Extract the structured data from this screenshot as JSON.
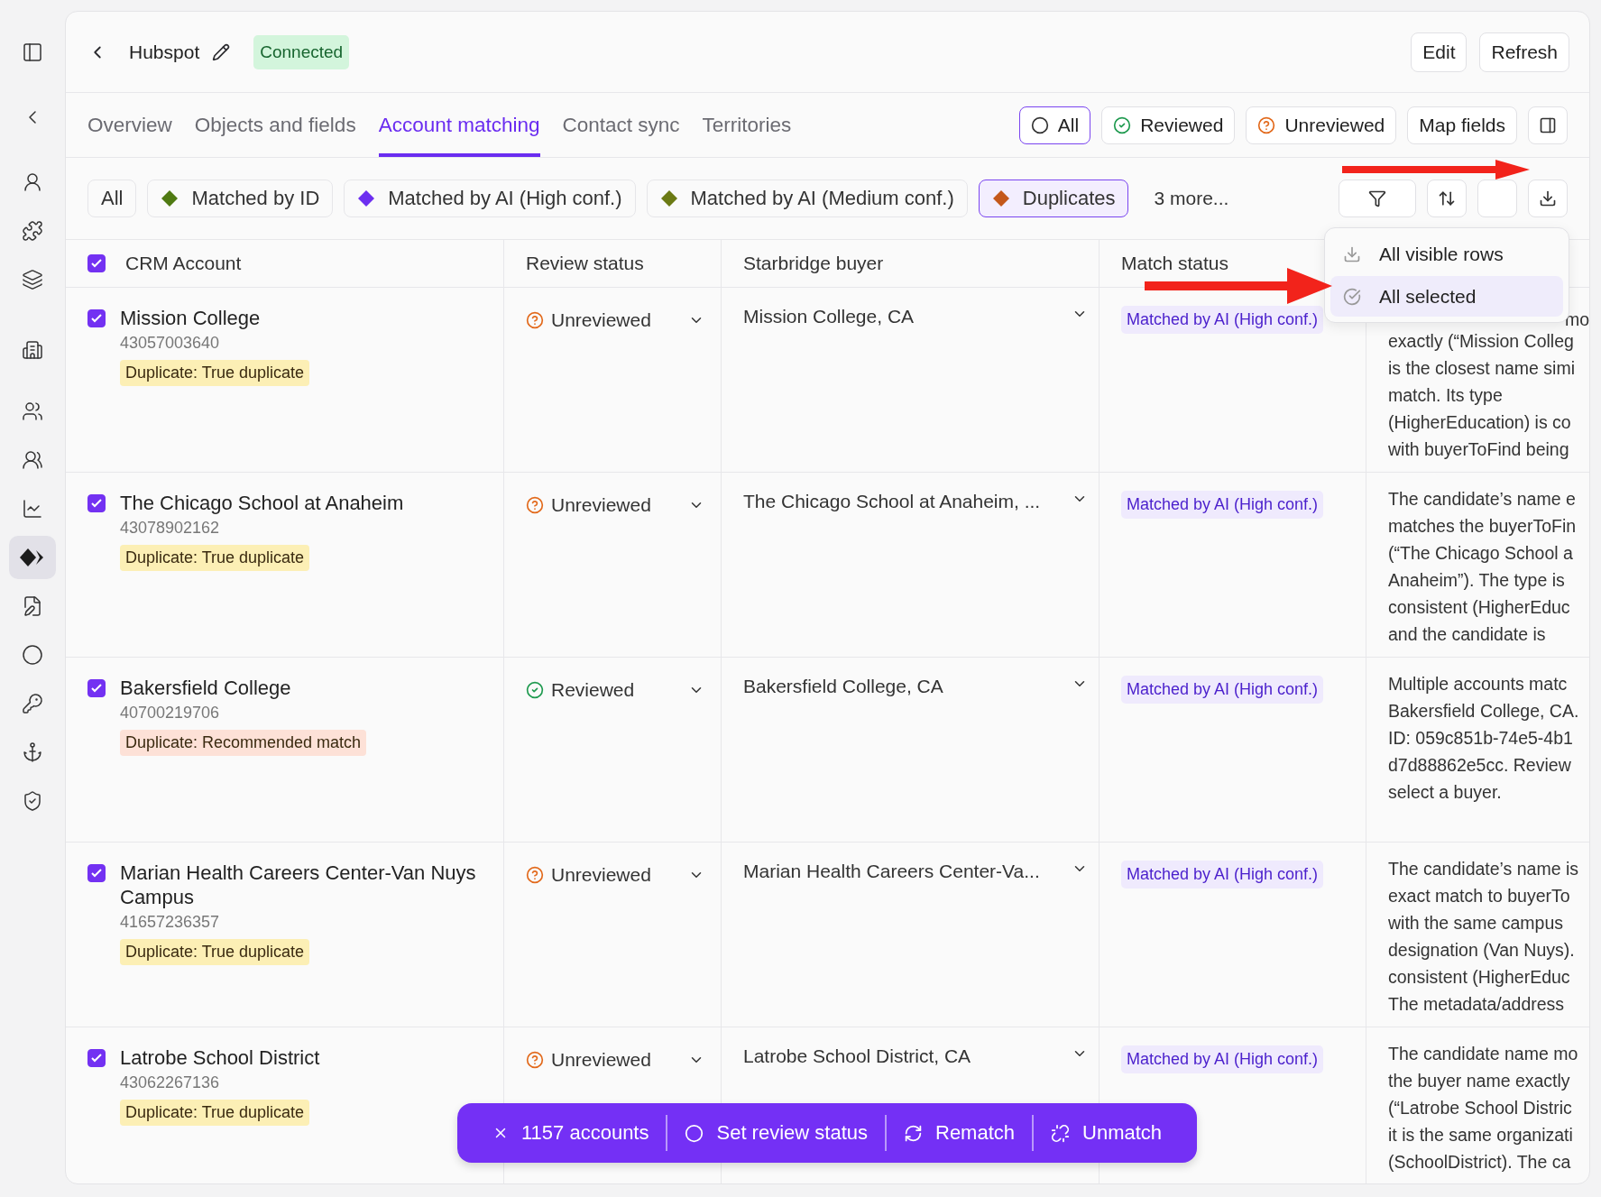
{
  "sidebar": {
    "items": [
      {
        "selected": false
      },
      {
        "selected": false
      },
      {
        "selected": false
      },
      {
        "selected": false
      },
      {
        "selected": false
      },
      {
        "selected": false
      },
      {
        "selected": false
      },
      {
        "selected": false
      },
      {
        "selected": false
      },
      {
        "selected": true
      },
      {
        "selected": false
      },
      {
        "selected": false
      },
      {
        "selected": false
      },
      {
        "selected": false
      },
      {
        "selected": false
      }
    ]
  },
  "header": {
    "title": "Hubspot",
    "status": "Connected",
    "buttons": [
      "Edit",
      "Refresh"
    ]
  },
  "tabs": [
    {
      "label": "Overview",
      "selected": false
    },
    {
      "label": "Objects and fields",
      "selected": false
    },
    {
      "label": "Account matching",
      "selected": true
    },
    {
      "label": "Contact sync",
      "selected": false
    },
    {
      "label": "Territories",
      "selected": false
    }
  ],
  "review_filter": [
    {
      "label": "All",
      "kind": "all",
      "selected": true
    },
    {
      "label": "Reviewed",
      "kind": "reviewed",
      "selected": false
    },
    {
      "label": "Unreviewed",
      "kind": "unreviewed",
      "selected": false
    }
  ],
  "map_fields": "Map fields",
  "match_filters": [
    {
      "label": "All",
      "selected": false
    },
    {
      "label": "Matched by ID",
      "color": "#4f7a12",
      "selected": false
    },
    {
      "label": "Matched by AI (High conf.)",
      "color": "#6d2ff0",
      "selected": false
    },
    {
      "label": "Matched by AI (Medium conf.)",
      "color": "#6b7a14",
      "selected": false
    },
    {
      "label": "Duplicates",
      "color": "#c4581a",
      "selected": true
    }
  ],
  "more_filters": "3 more...",
  "export_menu": [
    {
      "label": "All visible rows",
      "kind": "download",
      "selected": false
    },
    {
      "label": "All selected",
      "kind": "check",
      "selected": true
    }
  ],
  "table": {
    "all_checked": true,
    "columns": [
      "CRM Account",
      "Review status",
      "Starbridge buyer",
      "Match status"
    ],
    "rows": [
      {
        "checked": true,
        "name": "Mission College",
        "id": "43057003640",
        "badge": {
          "text": "Duplicate: True duplicate",
          "kind": "true"
        },
        "review": {
          "text": "Unreviewed",
          "kind": "unreviewed"
        },
        "buyer": "Mission College, CA",
        "match": "Matched by AI (High conf.)",
        "reason_fragment": "mo",
        "reason": [
          "exactly (“Mission Colleg",
          "is the closest name simi",
          "match. Its type",
          "(HigherEducation) is co",
          "with buyerToFind being"
        ]
      },
      {
        "checked": true,
        "name": "The Chicago School at Anaheim",
        "id": "43078902162",
        "badge": {
          "text": "Duplicate: True duplicate",
          "kind": "true"
        },
        "review": {
          "text": "Unreviewed",
          "kind": "unreviewed"
        },
        "buyer": "The Chicago School at Anaheim, ...",
        "match": "Matched by AI (High conf.)",
        "reason": [
          "The candidate’s name e",
          "matches the buyerToFin",
          "(“The Chicago School a",
          "Anaheim”). The type is",
          "consistent (HigherEduc",
          "and the candidate is"
        ]
      },
      {
        "checked": true,
        "name": "Bakersfield College",
        "id": "40700219706",
        "badge": {
          "text": "Duplicate: Recommended match",
          "kind": "recommended"
        },
        "review": {
          "text": "Reviewed",
          "kind": "reviewed"
        },
        "buyer": "Bakersfield College, CA",
        "match": "Matched by AI (High conf.)",
        "reason": [
          "Multiple accounts matc",
          "Bakersfield College, CA.",
          "ID: 059c851b-74e5-4b1",
          "d7d88862e5cc. Review",
          "select a buyer."
        ]
      },
      {
        "checked": true,
        "name": "Marian Health Careers Center-Van Nuys Campus",
        "id": "41657236357",
        "badge": {
          "text": "Duplicate: True duplicate",
          "kind": "true"
        },
        "review": {
          "text": "Unreviewed",
          "kind": "unreviewed"
        },
        "buyer": "Marian Health Careers Center-Va...",
        "match": "Matched by AI (High conf.)",
        "reason": [
          "The candidate’s name is",
          "exact match to buyerTo",
          "with the same campus",
          "designation (Van Nuys).",
          "consistent (HigherEduc",
          "The metadata/address"
        ]
      },
      {
        "checked": true,
        "name": "Latrobe School District",
        "id": "43062267136",
        "badge": {
          "text": "Duplicate: True duplicate",
          "kind": "true"
        },
        "review": {
          "text": "Unreviewed",
          "kind": "unreviewed"
        },
        "buyer": "Latrobe School District, CA",
        "match": "Matched by AI (High conf.)",
        "reason": [
          "The candidate name mo",
          "the buyer name exactly",
          "(“Latrobe School Distric",
          "it is the same organizati",
          "(SchoolDistrict). The ca"
        ]
      }
    ]
  },
  "action_bar": {
    "count": "1157 accounts",
    "actions": [
      {
        "label": "Set review status",
        "kind": "status"
      },
      {
        "label": "Rematch",
        "kind": "rematch"
      },
      {
        "label": "Unmatch",
        "kind": "unmatch"
      }
    ]
  }
}
